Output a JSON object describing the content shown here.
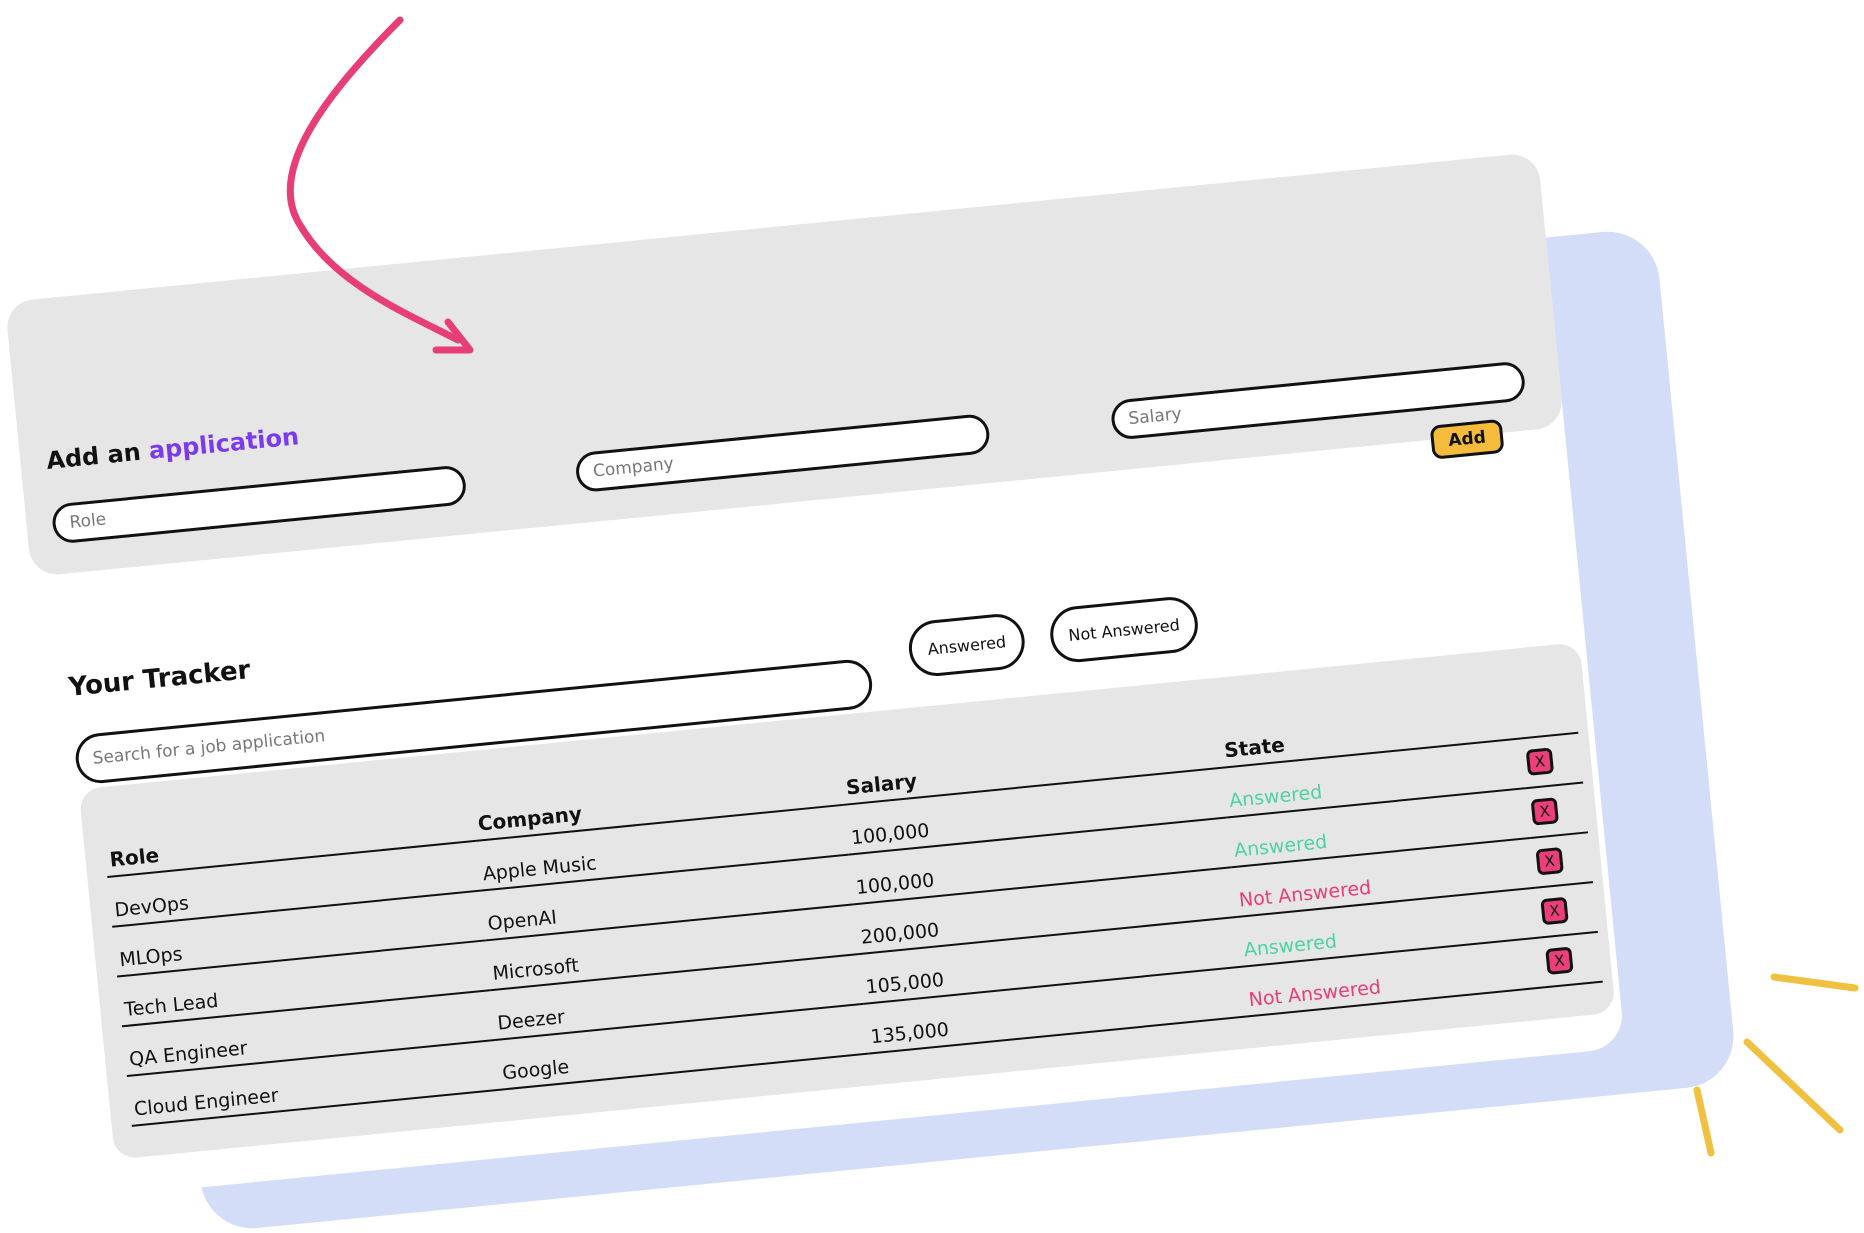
{
  "add_section": {
    "title_prefix": "Add an",
    "title_accent": "application",
    "role_placeholder": "Role",
    "company_placeholder": "Company",
    "salary_placeholder": "Salary",
    "add_label": "Add"
  },
  "tracker": {
    "title": "Your Tracker",
    "search_placeholder": "Search for a job application",
    "filters": {
      "answered": "Answered",
      "not_answered": "Not Answered"
    },
    "columns": {
      "role": "Role",
      "company": "Company",
      "salary": "Salary",
      "state": "State"
    },
    "delete_label": "X",
    "rows": [
      {
        "role": "DevOps",
        "company": "Apple Music",
        "salary": "100,000",
        "state": "Answered"
      },
      {
        "role": "MLOps",
        "company": "OpenAI",
        "salary": "100,000",
        "state": "Answered"
      },
      {
        "role": "Tech Lead",
        "company": "Microsoft",
        "salary": "200,000",
        "state": "Not Answered"
      },
      {
        "role": "QA Engineer",
        "company": "Deezer",
        "salary": "105,000",
        "state": "Answered"
      },
      {
        "role": "Cloud Engineer",
        "company": "Google",
        "salary": "135,000",
        "state": "Not Answered"
      }
    ]
  },
  "colors": {
    "answered": "#4cd4a0",
    "not_answered": "#e83e78",
    "accent": "#7c3aed",
    "add_button": "#f4bb3d",
    "arrow": "#e83e78",
    "sparkles": "#f0c040",
    "backdrop": "#d4ddf8",
    "panel": "#e6e6e6"
  },
  "decorations": {
    "arrow_icon": "curved-arrow-icon",
    "sparkle_icon": "sparkle-lines-icon"
  }
}
